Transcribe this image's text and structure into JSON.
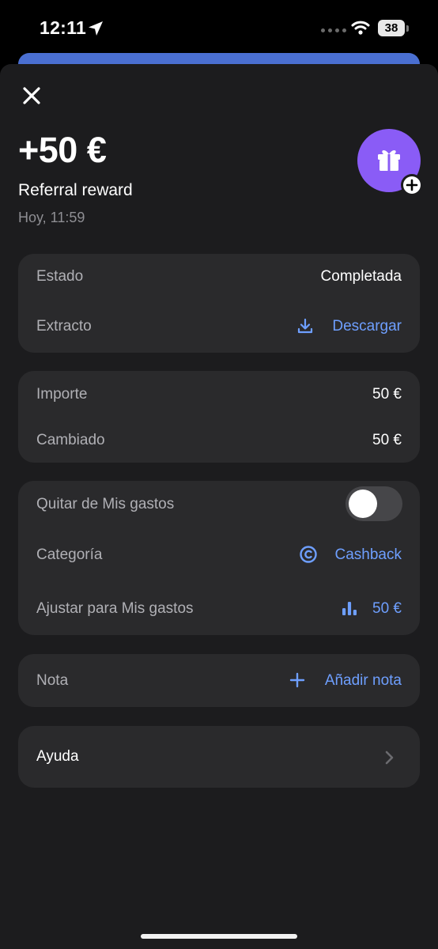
{
  "status_bar": {
    "time": "12:11",
    "battery": "38"
  },
  "header": {
    "amount": "+50 €",
    "title": "Referral reward",
    "date": "Hoy, 11:59"
  },
  "details": {
    "estado_label": "Estado",
    "estado_value": "Completada",
    "extracto_label": "Extracto",
    "extracto_action": "Descargar"
  },
  "amounts": {
    "importe_label": "Importe",
    "importe_value": "50 €",
    "cambiado_label": "Cambiado",
    "cambiado_value": "50 €"
  },
  "spending": {
    "quitar_label": "Quitar de Mis gastos",
    "quitar_toggle_on": false,
    "categoria_label": "Categoría",
    "categoria_value": "Cashback",
    "ajustar_label": "Ajustar para Mis gastos",
    "ajustar_value": "50 €"
  },
  "note": {
    "label": "Nota",
    "action": "Añadir nota"
  },
  "help": {
    "label": "Ayuda"
  },
  "colors": {
    "accent": "#6e9fff",
    "avatar": "#8a5cf6",
    "sheet": "#1c1c1e",
    "card": "#2a2a2c",
    "behind_card": "#4a6fd1"
  },
  "icons": [
    "location-arrow-icon",
    "wifi-icon",
    "close-icon",
    "gift-icon",
    "plus-badge-icon",
    "download-icon",
    "cashback-icon",
    "bar-chart-icon",
    "plus-icon",
    "chevron-right-icon"
  ]
}
